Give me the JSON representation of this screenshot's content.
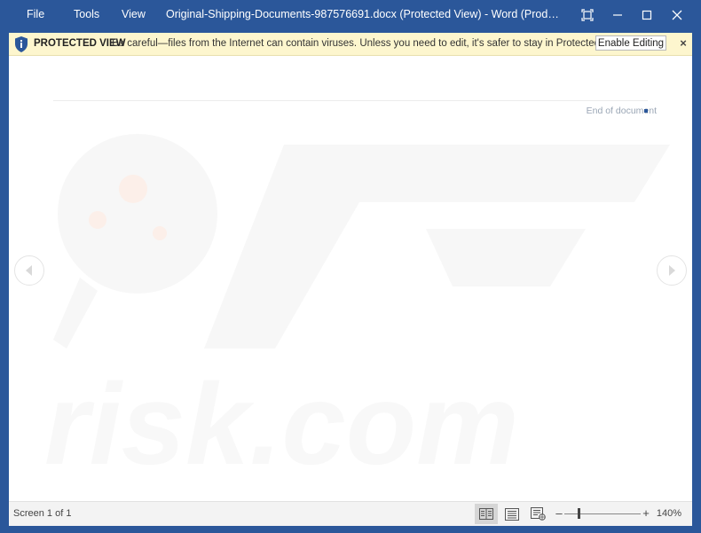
{
  "titlebar": {
    "menu": [
      {
        "label": "File"
      },
      {
        "label": "Tools"
      },
      {
        "label": "View"
      }
    ],
    "document_title": "Original-Shipping-Documents-987576691.docx (Protected View) - Word (Product Activation F..."
  },
  "protected_view": {
    "title": "PROTECTED VIEW",
    "message": "Be careful—files from the Internet can contain viruses. Unless you need to edit, it's safer to stay in Protected View.",
    "enable_label": "Enable Editing",
    "close_glyph": "×",
    "background_color": "#fdf6ce"
  },
  "document": {
    "end_text": "End of document"
  },
  "status_bar": {
    "screen_text": "Screen 1 of 1",
    "zoom_minus": "–",
    "zoom_plus": "+",
    "zoom_level": "140%",
    "zoom_value": 140
  },
  "icons": {
    "shield": "shield-info-icon",
    "restore_layout": "full-screen-icon",
    "minimize": "minimize-icon",
    "maximize": "maximize-icon",
    "close": "close-icon",
    "prev": "chevron-left-icon",
    "next": "chevron-right-icon",
    "read_mode": "read-mode-icon",
    "print_layout": "print-layout-icon",
    "web_layout": "web-layout-icon"
  },
  "colors": {
    "accent": "#2b579a",
    "statusbar": "#f3f3f3"
  }
}
